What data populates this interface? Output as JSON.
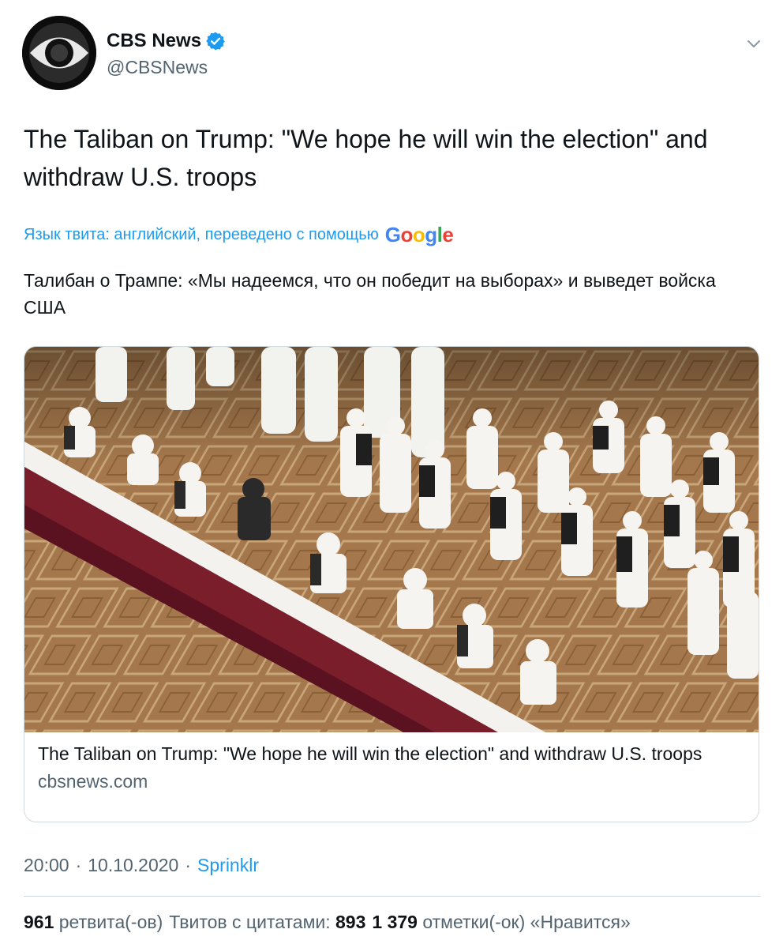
{
  "author": {
    "name": "CBS News",
    "handle": "@CBSNews",
    "verified": true,
    "avatar_icon": "cbs-eye-logo-icon"
  },
  "tweet": {
    "text": "The Taliban on Trump: \"We hope he will win the election\" and withdraw U.S. troops"
  },
  "translation": {
    "notice": "Язык твита: английский, переведено с помощью",
    "provider": "Google",
    "text": "Талибан о Трампе: «Мы надеемся, что он победит на выборах» и выведет войска США"
  },
  "card": {
    "title": "The Taliban on Trump: \"We hope he will win the election\" and withdraw U.S. troops",
    "domain": "cbsnews.com"
  },
  "meta": {
    "time": "20:00",
    "date": "10.10.2020",
    "separator": "·",
    "source": "Sprinklr"
  },
  "stats": {
    "retweets_count": "961",
    "retweets_label": "ретвита(-ов)",
    "quotes_label": "Твитов с цитатами:",
    "quotes_count": "893",
    "likes_count": "1 379",
    "likes_label": "отметки(-ок) «Нравится»"
  },
  "colors": {
    "link": "#1d9bf0",
    "secondary_text": "#536471",
    "verified": "#1d9bf0"
  }
}
